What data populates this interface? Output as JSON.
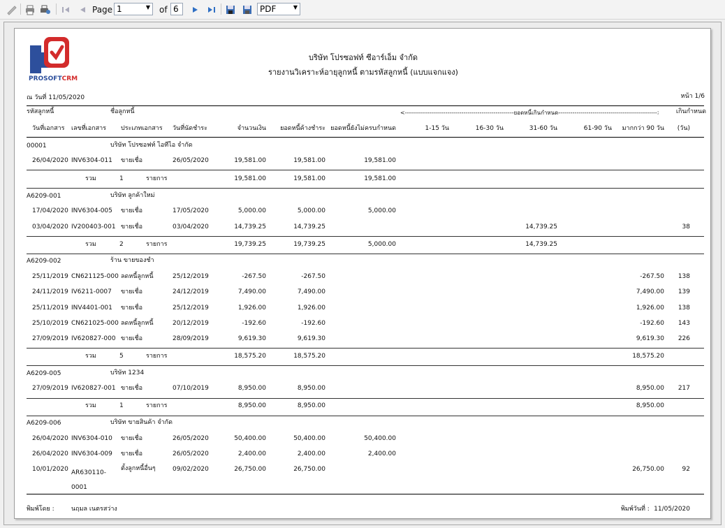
{
  "toolbar": {
    "page_label": "Page",
    "page_value": "1",
    "of_label": "of",
    "total_pages": "6",
    "export_format": "PDF"
  },
  "report": {
    "logo_text_a": "PROSOFT",
    "logo_text_b": "CRM",
    "company": "บริษัท โปรซอฟท์ ซีอาร์เอ็ม จำกัด",
    "title": "รายงานวิเคราะห์อายุลูกหนี้ ตามรหัสลูกหนี้ (แบบแจกแจง)",
    "as_of": "ณ วันที่ 11/05/2020",
    "page_no": "หน้า 1/6",
    "headers": {
      "customer_code": "รหัสลูกหนี้",
      "customer_name": "ชื่อลูกหนี้",
      "overdue_group": "<------------------------------------------------------ยอดหนี้เกินกำหนด------------------------------------------------->",
      "overdue": "เกินกำหนด",
      "doc_date": "วันที่เอกสาร",
      "doc_no": "เลขที่เอกสาร",
      "doc_type": "ประเภทเอกสาร",
      "due_date": "วันที่นัดชำระ",
      "amount": "จำนวนเงิน",
      "balance": "ยอดหนี้ค้างชำระ",
      "not_due": "ยอดหนี้ยังไม่ครบกำหนด",
      "d1_15": "1-15 วัน",
      "d16_30": "16-30 วัน",
      "d31_60": "31-60 วัน",
      "d61_90": "61-90 วัน",
      "d90": "มากกว่า 90 วัน",
      "days": "(วัน)"
    },
    "groups": [
      {
        "code": "00001",
        "name": "บริษัท โปรซอฟท์ ไอทีไอ  จำกัด",
        "rows": [
          {
            "date": "26/04/2020",
            "doc": "INV6304-011",
            "type": "ขายเชื่อ",
            "due": "26/05/2020",
            "amount": "19,581.00",
            "balance": "19,581.00",
            "notdue": "19,581.00",
            "d31": "",
            "d90": "",
            "days": ""
          }
        ],
        "total": {
          "label": "รวม",
          "count": "1",
          "unit": "รายการ",
          "amount": "19,581.00",
          "balance": "19,581.00",
          "notdue": "19,581.00",
          "d31": "",
          "d90": ""
        }
      },
      {
        "code": "A6209-001",
        "name": "บริษัท ลูกค้าใหม่",
        "rows": [
          {
            "date": "17/04/2020",
            "doc": "INV6304-005",
            "type": "ขายเชื่อ",
            "due": "17/05/2020",
            "amount": "5,000.00",
            "balance": "5,000.00",
            "notdue": "5,000.00",
            "d31": "",
            "d90": "",
            "days": ""
          },
          {
            "date": "03/04/2020",
            "doc": "IV200403-001",
            "type": "ขายเชื่อ",
            "due": "03/04/2020",
            "amount": "14,739.25",
            "balance": "14,739.25",
            "notdue": "",
            "d31": "14,739.25",
            "d90": "",
            "days": "38"
          }
        ],
        "total": {
          "label": "รวม",
          "count": "2",
          "unit": "รายการ",
          "amount": "19,739.25",
          "balance": "19,739.25",
          "notdue": "5,000.00",
          "d31": "14,739.25",
          "d90": ""
        }
      },
      {
        "code": "A6209-002",
        "name": "ร้าน ขายของชำ",
        "rows": [
          {
            "date": "25/11/2019",
            "doc": "CN621125-000",
            "type": "ลดหนี้ลูกหนี้",
            "due": "25/12/2019",
            "amount": "-267.50",
            "balance": "-267.50",
            "notdue": "",
            "d31": "",
            "d90": "-267.50",
            "days": "138"
          },
          {
            "date": "24/11/2019",
            "doc": "IV6211-0007",
            "type": "ขายเชื่อ",
            "due": "24/12/2019",
            "amount": "7,490.00",
            "balance": "7,490.00",
            "notdue": "",
            "d31": "",
            "d90": "7,490.00",
            "days": "139"
          },
          {
            "date": "25/11/2019",
            "doc": "INV4401-001",
            "type": "ขายเชื่อ",
            "due": "25/12/2019",
            "amount": "1,926.00",
            "balance": "1,926.00",
            "notdue": "",
            "d31": "",
            "d90": "1,926.00",
            "days": "138"
          },
          {
            "date": "25/10/2019",
            "doc": "CN621025-000",
            "type": "ลดหนี้ลูกหนี้",
            "due": "20/12/2019",
            "amount": "-192.60",
            "balance": "-192.60",
            "notdue": "",
            "d31": "",
            "d90": "-192.60",
            "days": "143"
          },
          {
            "date": "27/09/2019",
            "doc": "IV620827-000",
            "type": "ขายเชื่อ",
            "due": "28/09/2019",
            "amount": "9,619.30",
            "balance": "9,619.30",
            "notdue": "",
            "d31": "",
            "d90": "9,619.30",
            "days": "226"
          }
        ],
        "total": {
          "label": "รวม",
          "count": "5",
          "unit": "รายการ",
          "amount": "18,575.20",
          "balance": "18,575.20",
          "notdue": "",
          "d31": "",
          "d90": "18,575.20"
        }
      },
      {
        "code": "A6209-005",
        "name": "บริษัท 1234",
        "rows": [
          {
            "date": "27/09/2019",
            "doc": "IV620827-001",
            "type": "ขายเชื่อ",
            "due": "07/10/2019",
            "amount": "8,950.00",
            "balance": "8,950.00",
            "notdue": "",
            "d31": "",
            "d90": "8,950.00",
            "days": "217"
          }
        ],
        "total": {
          "label": "รวม",
          "count": "1",
          "unit": "รายการ",
          "amount": "8,950.00",
          "balance": "8,950.00",
          "notdue": "",
          "d31": "",
          "d90": "8,950.00"
        }
      },
      {
        "code": "A6209-006",
        "name": "บริษัท ขายสินค้า จำกัด",
        "rows": [
          {
            "date": "26/04/2020",
            "doc": "INV6304-010",
            "type": "ขายเชื่อ",
            "due": "26/05/2020",
            "amount": "50,400.00",
            "balance": "50,400.00",
            "notdue": "50,400.00",
            "d31": "",
            "d90": "",
            "days": ""
          },
          {
            "date": "26/04/2020",
            "doc": "INV6304-009",
            "type": "ขายเชื่อ",
            "due": "26/05/2020",
            "amount": "2,400.00",
            "balance": "2,400.00",
            "notdue": "2,400.00",
            "d31": "",
            "d90": "",
            "days": ""
          },
          {
            "date": "10/01/2020",
            "doc": "AR630110-0001",
            "type": "ตั้งลูกหนี้อื่นๆ",
            "due": "09/02/2020",
            "amount": "26,750.00",
            "balance": "26,750.00",
            "notdue": "",
            "d31": "",
            "d90": "26,750.00",
            "days": "92"
          }
        ]
      }
    ],
    "footer": {
      "printed_by_label": "พิมพ์โดย :",
      "printed_by": "นฤมล เนตรสว่าง",
      "print_date_label": "พิมพ์วันที่ :",
      "print_date": "11/05/2020"
    }
  }
}
